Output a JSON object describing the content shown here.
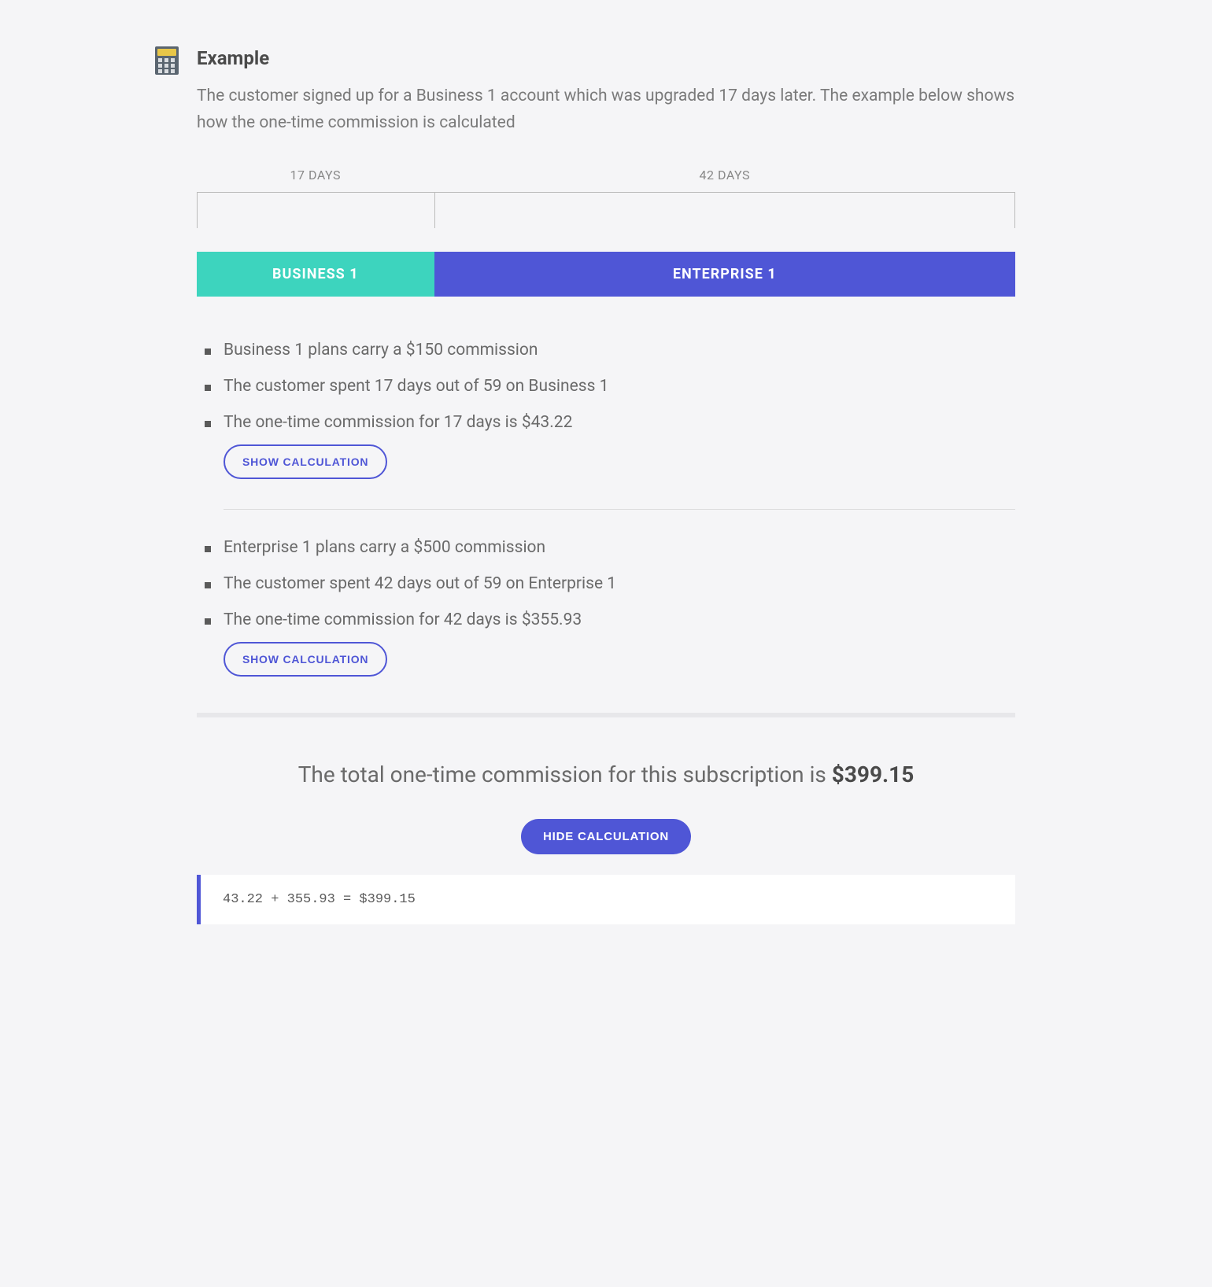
{
  "header": {
    "title": "Example",
    "intro": "The customer signed up for a Business 1 account which was upgraded 17 days later. The example below shows how the one-time commission is calculated"
  },
  "timeline": {
    "left_label": "17 DAYS",
    "right_label": "42 DAYS"
  },
  "plan_bar": {
    "left": "BUSINESS 1",
    "right": "ENTERPRISE 1"
  },
  "business": {
    "bullets": [
      "Business 1 plans carry a $150 commission",
      "The customer spent 17 days out of 59 on Business 1",
      "The one-time commission for 17 days is $43.22"
    ],
    "button": "SHOW CALCULATION"
  },
  "enterprise": {
    "bullets": [
      "Enterprise 1 plans carry a $500 commission",
      "The customer spent 42 days out of 59 on Enterprise 1",
      "The one-time commission for 42 days is $355.93"
    ],
    "button": "SHOW CALCULATION"
  },
  "total": {
    "text": "The total one-time commission for this subscription is ",
    "amount": "$399.15",
    "button": "HIDE CALCULATION",
    "formula": "43.22 + 355.93 = $399.15"
  }
}
